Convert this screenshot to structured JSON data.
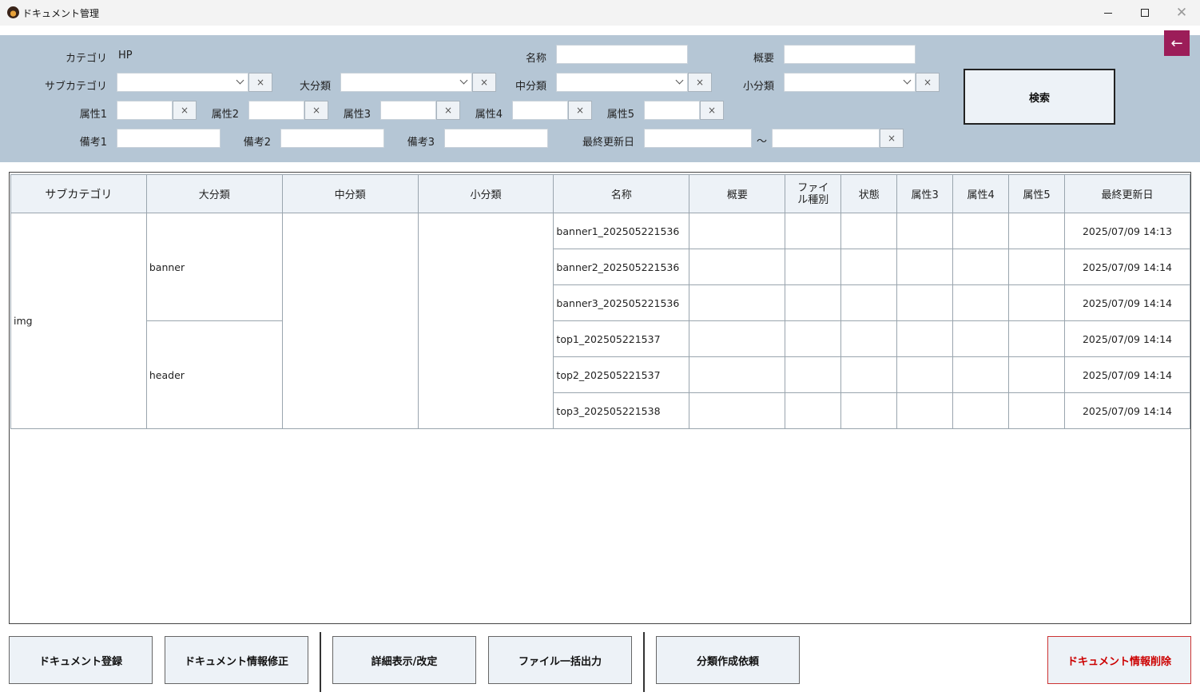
{
  "window": {
    "title": "ドキュメント管理"
  },
  "filter": {
    "category_label": "カテゴリ",
    "category_value": "HP",
    "name_label": "名称",
    "summary_label": "概要",
    "subcategory_label": "サブカテゴリ",
    "major_label": "大分類",
    "middle_label": "中分類",
    "minor_label": "小分類",
    "attr1_label": "属性1",
    "attr2_label": "属性2",
    "attr3_label": "属性3",
    "attr4_label": "属性4",
    "attr5_label": "属性5",
    "note1_label": "備考1",
    "note2_label": "備考2",
    "note3_label": "備考3",
    "updated_label": "最終更新日",
    "range_sep": "～",
    "clear_symbol": "×",
    "search_label": "検索",
    "back_symbol": "←"
  },
  "table": {
    "headers": {
      "subcategory": "サブカテゴリ",
      "major": "大分類",
      "middle": "中分類",
      "minor": "小分類",
      "name": "名称",
      "summary": "概要",
      "filetype_1": "ファイ",
      "filetype_2": "ル種別",
      "status": "状態",
      "attr3": "属性3",
      "attr4": "属性4",
      "attr5": "属性5",
      "updated": "最終更新日"
    },
    "groups": {
      "subcategory": "img",
      "major_1": "banner",
      "major_2": "header"
    },
    "rows": [
      {
        "name": "banner1_202505221536",
        "updated": "2025/07/09 14:13"
      },
      {
        "name": "banner2_202505221536",
        "updated": "2025/07/09 14:14"
      },
      {
        "name": "banner3_202505221536",
        "updated": "2025/07/09 14:14"
      },
      {
        "name": "top1_202505221537",
        "updated": "2025/07/09 14:14"
      },
      {
        "name": "top2_202505221537",
        "updated": "2025/07/09 14:14"
      },
      {
        "name": "top3_202505221538",
        "updated": "2025/07/09 14:14"
      }
    ]
  },
  "actions": {
    "register": "ドキュメント登録",
    "edit_info": "ドキュメント情報修正",
    "detail": "詳細表示/改定",
    "export": "ファイル一括出力",
    "request_category": "分類作成依頼",
    "delete": "ドキュメント情報削除"
  }
}
